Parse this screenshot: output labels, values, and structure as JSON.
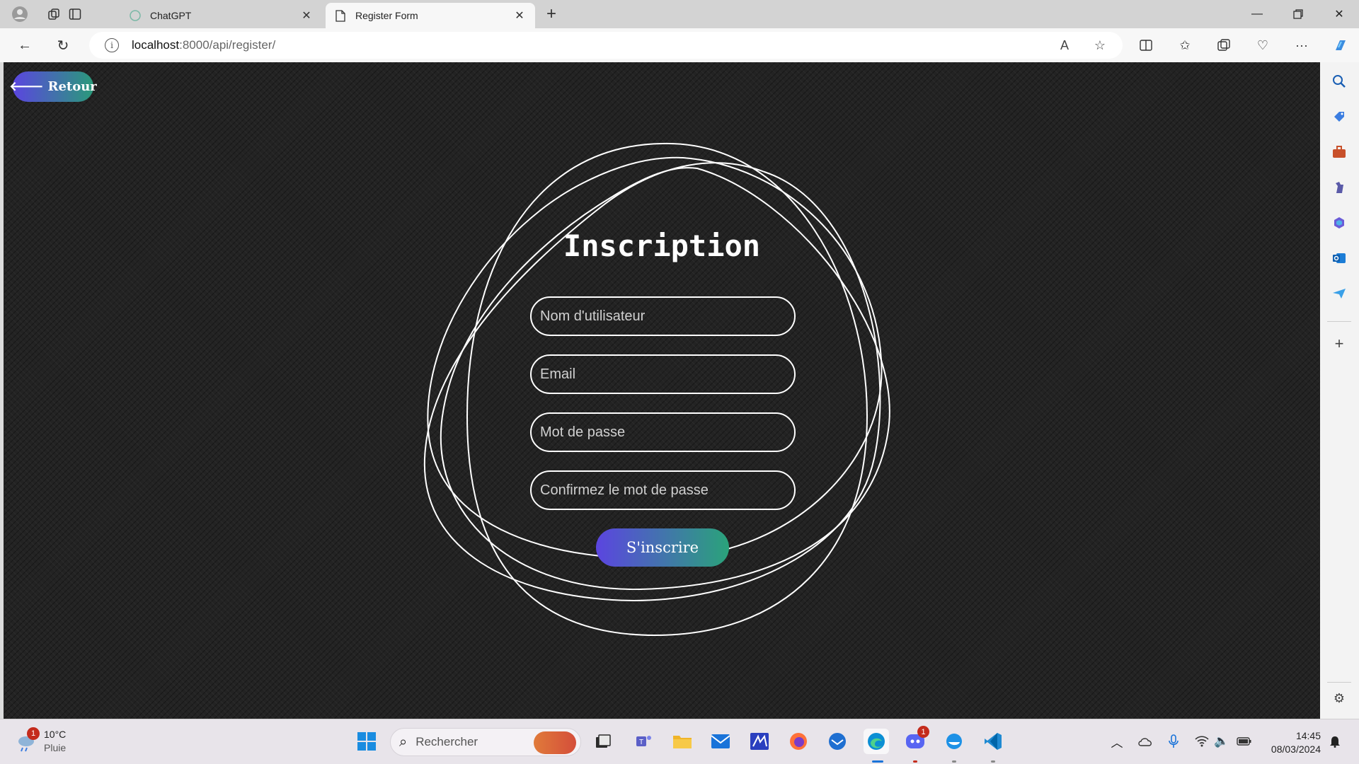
{
  "browser": {
    "tabs": [
      {
        "title": "ChatGPT",
        "active": false
      },
      {
        "title": "Register Form",
        "active": true
      }
    ],
    "url_host": "localhost",
    "url_path": ":8000/api/register/"
  },
  "page": {
    "back_label": "Retour",
    "form_title": "Inscription",
    "fields": {
      "username_placeholder": "Nom d'utilisateur",
      "email_placeholder": "Email",
      "password_placeholder": "Mot de passe",
      "confirm_placeholder": "Confirmez le mot de passe"
    },
    "submit_label": "S'inscrire"
  },
  "taskbar": {
    "weather_temp": "10°C",
    "weather_condition": "Pluie",
    "weather_badge": "1",
    "search_placeholder": "Rechercher",
    "discord_badge": "1",
    "time": "14:45",
    "date": "08/03/2024"
  },
  "colors": {
    "accent_start": "#5b45e0",
    "accent_end": "#2aa37a",
    "page_bg": "#232323"
  }
}
